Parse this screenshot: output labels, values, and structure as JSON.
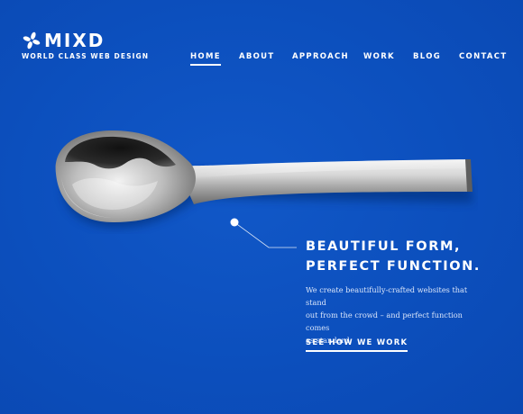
{
  "brand": {
    "name": "MIXD",
    "tagline": "WORLD CLASS WEB DESIGN"
  },
  "nav": {
    "items": [
      {
        "label": "HOME",
        "active": true
      },
      {
        "label": "ABOUT",
        "active": false
      },
      {
        "label": "APPROACH",
        "active": false
      },
      {
        "label": "WORK",
        "active": false
      },
      {
        "label": "BLOG",
        "active": false
      },
      {
        "label": "CONTACT",
        "active": false
      }
    ]
  },
  "hero": {
    "headline_line1": "BEAUTIFUL FORM,",
    "headline_line2": "PERFECT FUNCTION.",
    "body_line1": "We create beautifully-crafted websites that stand",
    "body_line2": "out from the crowd – and perfect function comes",
    "body_line3": "as standard.",
    "cta_label": "SEE HOW WE WORK"
  },
  "colors": {
    "background": "#0c4fbd",
    "text": "#ffffff"
  }
}
